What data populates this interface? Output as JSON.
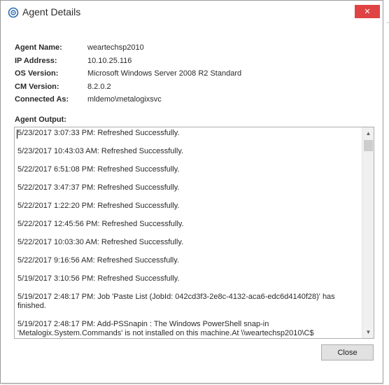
{
  "window": {
    "title": "Agent Details",
    "close_glyph": "✕"
  },
  "details": [
    {
      "label": "Agent Name:",
      "value": "weartechsp2010"
    },
    {
      "label": "IP Address:",
      "value": "10.10.25.116"
    },
    {
      "label": "OS Version:",
      "value": "Microsoft Windows Server 2008 R2 Standard"
    },
    {
      "label": "CM Version:",
      "value": "8.2.0.2"
    },
    {
      "label": "Connected As:",
      "value": "mldemo\\metalogixsvc"
    }
  ],
  "output": {
    "label": "Agent Output:",
    "entries": [
      "5/23/2017 3:07:33 PM: Refreshed Successfully.",
      "5/23/2017 10:43:03 AM: Refreshed Successfully.",
      "5/22/2017 6:51:08 PM: Refreshed Successfully.",
      "5/22/2017 3:47:37 PM: Refreshed Successfully.",
      "5/22/2017 1:22:20 PM: Refreshed Successfully.",
      "5/22/2017 12:45:56 PM: Refreshed Successfully.",
      "5/22/2017 10:03:30 AM: Refreshed Successfully.",
      "5/22/2017 9:16:56 AM: Refreshed Successfully.",
      "5/19/2017 3:10:56 PM: Refreshed Successfully.",
      "5/19/2017 2:48:17 PM: Job 'Paste List (JobId: 042cd3f3-2e8c-4132-aca6-edc6d4140f28)' has finished.",
      "5/19/2017 2:48:17 PM: Add-PSSnapin : The Windows PowerShell snap-in 'Metalogix.System.Commands' is not installed on this machine.At \\\\weartechsp2010\\C$"
    ]
  },
  "buttons": {
    "close_label": "Close"
  },
  "icons": {
    "app": "agent-icon",
    "scroll_up": "▲",
    "scroll_down": "▼"
  },
  "colors": {
    "close_button_bg": "#e04343",
    "app_icon": "#2b6cb0"
  }
}
